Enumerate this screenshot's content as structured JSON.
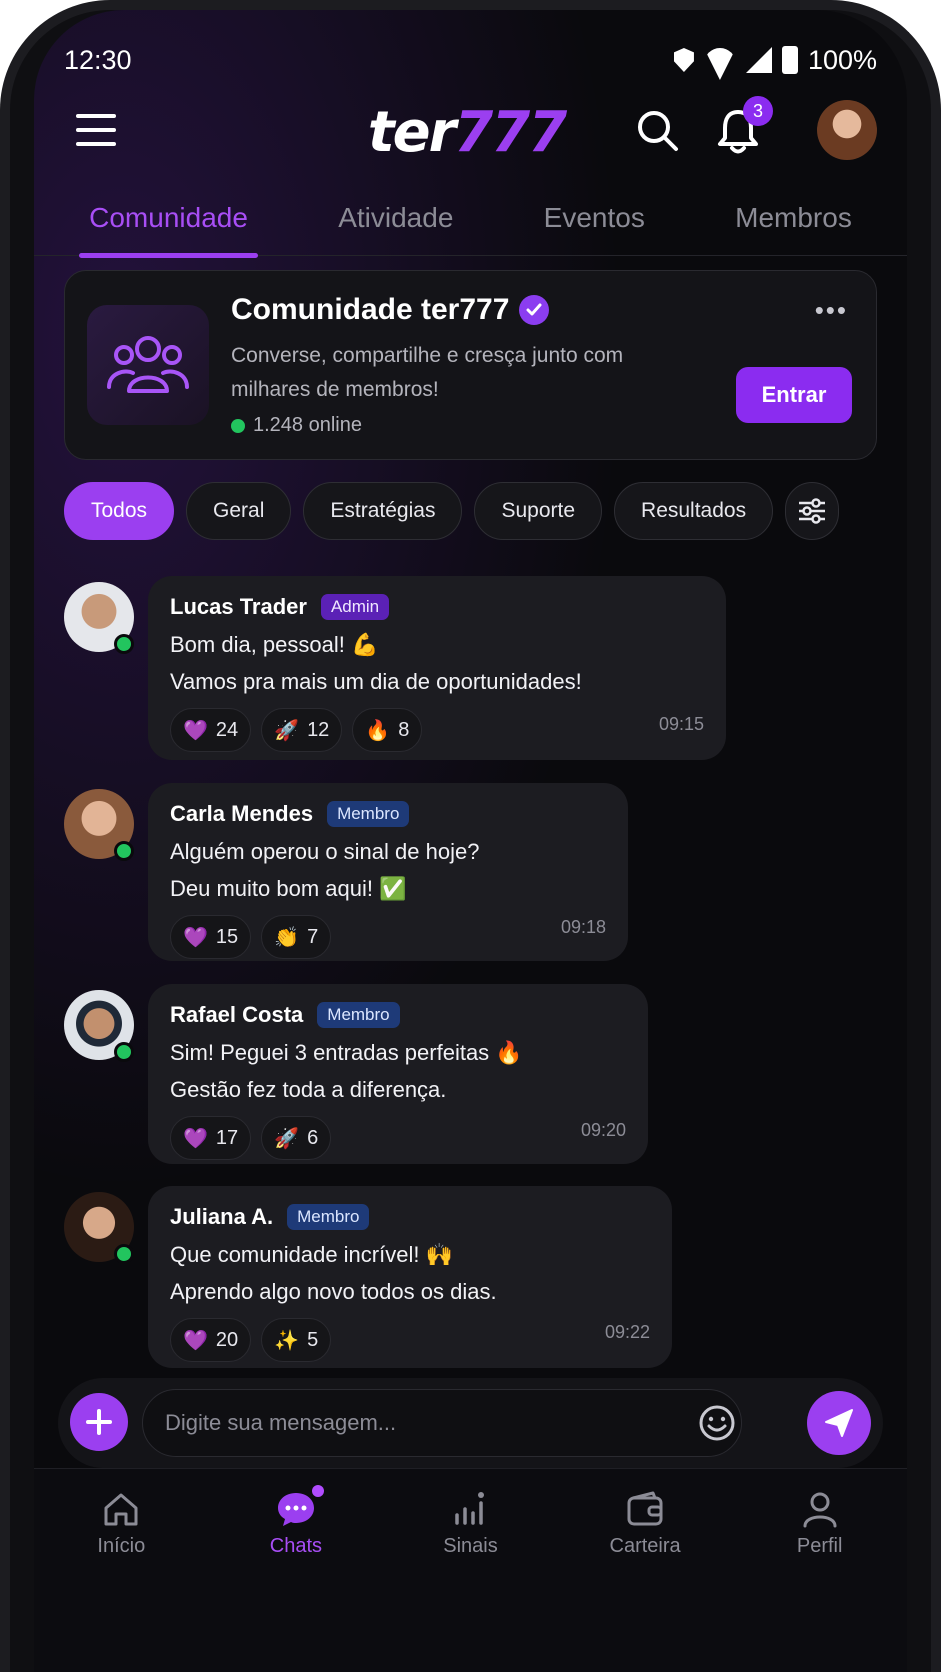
{
  "status": {
    "time": "12:30",
    "battery": "100%"
  },
  "header": {
    "logo_word": "ter",
    "logo_num": "777",
    "notification_count": "3"
  },
  "tabs": [
    {
      "label": "Comunidade"
    },
    {
      "label": "Atividade"
    },
    {
      "label": "Eventos"
    },
    {
      "label": "Membros"
    }
  ],
  "community": {
    "title": "Comunidade ter777",
    "description": "Converse, compartilhe e cresça junto com milhares de membros!",
    "online": "1.248 online",
    "join_label": "Entrar",
    "more": "•••"
  },
  "filters": [
    "Todos",
    "Geral",
    "Estratégias",
    "Suporte",
    "Resultados"
  ],
  "messages": [
    {
      "name": "Lucas Trader",
      "role": "Admin",
      "line1": "Bom dia, pessoal! 💪",
      "line2": "Vamos pra mais um dia de oportunidades!",
      "time": "09:15",
      "reactions": [
        {
          "emoji": "💜",
          "count": "24"
        },
        {
          "emoji": "🚀",
          "count": "12"
        },
        {
          "emoji": "🔥",
          "count": "8"
        }
      ]
    },
    {
      "name": "Carla Mendes",
      "role": "Membro",
      "line1": "Alguém operou o sinal de hoje?",
      "line2": "Deu muito bom aqui! ✅",
      "time": "09:18",
      "reactions": [
        {
          "emoji": "💜",
          "count": "15"
        },
        {
          "emoji": "👏",
          "count": "7"
        }
      ]
    },
    {
      "name": "Rafael Costa",
      "role": "Membro",
      "line1": "Sim! Peguei 3 entradas perfeitas 🔥",
      "line2": "Gestão fez toda a diferença.",
      "time": "09:20",
      "reactions": [
        {
          "emoji": "💜",
          "count": "17"
        },
        {
          "emoji": "🚀",
          "count": "6"
        }
      ]
    },
    {
      "name": "Juliana A.",
      "role": "Membro",
      "line1": "Que comunidade incrível! 🙌",
      "line2": "Aprendo algo novo todos os dias.",
      "time": "09:22",
      "reactions": [
        {
          "emoji": "💜",
          "count": "20"
        },
        {
          "emoji": "✨",
          "count": "5"
        }
      ]
    }
  ],
  "composer": {
    "placeholder": "Digite sua mensagem..."
  },
  "nav": [
    {
      "label": "Início"
    },
    {
      "label": "Chats"
    },
    {
      "label": "Sinais"
    },
    {
      "label": "Carteira"
    },
    {
      "label": "Perfil"
    }
  ],
  "colors": {
    "accent": "#9b3ff0",
    "online": "#22c55e",
    "background": "#0a0a0d"
  }
}
